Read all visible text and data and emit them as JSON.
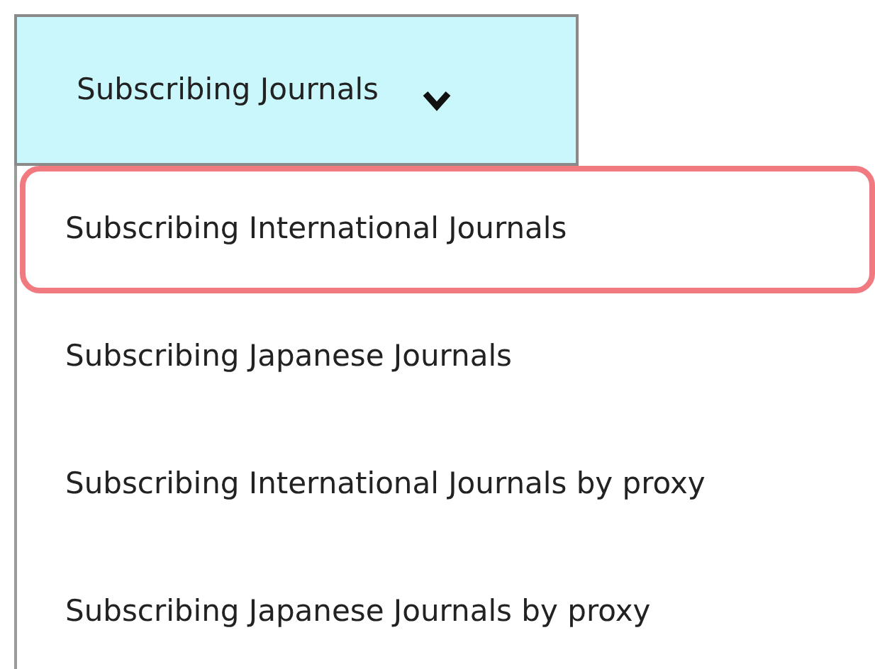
{
  "dropdown": {
    "label": "Subscribing Journals",
    "expanded": true
  },
  "menu_items": [
    {
      "label": "Subscribing International Journals",
      "selected": true
    },
    {
      "label": "Subscribing Japanese Journals",
      "selected": false
    },
    {
      "label": "Subscribing International Journals by proxy",
      "selected": false
    },
    {
      "label": "Subscribing Japanese Journals by proxy",
      "selected": false
    }
  ]
}
